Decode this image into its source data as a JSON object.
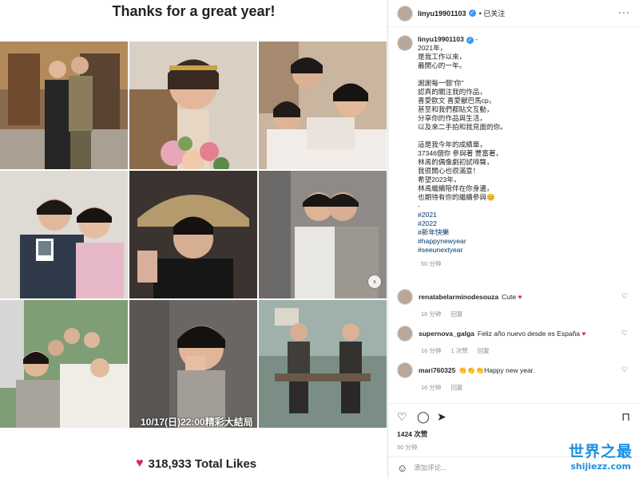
{
  "left": {
    "title": "Thanks for a great year!",
    "tile_caption": "10/17(日)22:00精彩大結局",
    "likes": "318,933 Total Likes"
  },
  "post": {
    "username": "linyu19901103",
    "follow_status": "已关注",
    "more": "···",
    "caption_user": "linyu19901103",
    "caption_suffix": " -",
    "caption_lines": [
      "2021年，",
      "是我工作以來，",
      "最開心的一年。",
      "",
      "謝謝每一個\"你\"",
      "認真的關注我的作品，",
      "喜愛歐文 喜愛獸巴馬cp，",
      "甚至和我們都貼文互動，",
      "分享你的作品與生活，",
      "以及來二手拍和我見面的你。",
      "",
      "這是我今年的成績單，",
      "37346個你 參與著 豐富著，",
      "林禹的偶像劇初試啼聲，",
      "我很開心也很滿意！",
      "希望2023年，",
      "林禹繼續陪伴在你身邊，",
      "也期待有你的繼續參與😊",
      "-"
    ],
    "hashtags": [
      "#2021",
      "#2022",
      "#新年快樂",
      "#happynewyear",
      "#seeunextyear"
    ],
    "caption_time": "50 分钟"
  },
  "comments": [
    {
      "user": "renatabelarminodesouza",
      "text": "Cute",
      "emoji": "♥",
      "time": "16 分钟",
      "reply": "回复",
      "likes": ""
    },
    {
      "user": "supernova_galga",
      "text": "Feliz año nuevo desde es España",
      "emoji": "♥",
      "time": "16 分钟",
      "likes": "1 次赞",
      "reply": "回复"
    },
    {
      "user": "mari760325",
      "text": "👏👏👏Happy new year.",
      "emoji": "",
      "time": "16 分钟",
      "reply": "回复",
      "likes": ""
    }
  ],
  "footer": {
    "like_count": "1424 次赞",
    "time": "50 分钟",
    "add_comment_placeholder": "添加评论..."
  },
  "watermark": {
    "line1": "世界之最",
    "line2": "shijiezz.com"
  },
  "colors": {
    "heart": "#e0245e",
    "verified": "#3897f0",
    "hashtag": "#00376b",
    "watermark": "#1a8fe0"
  }
}
